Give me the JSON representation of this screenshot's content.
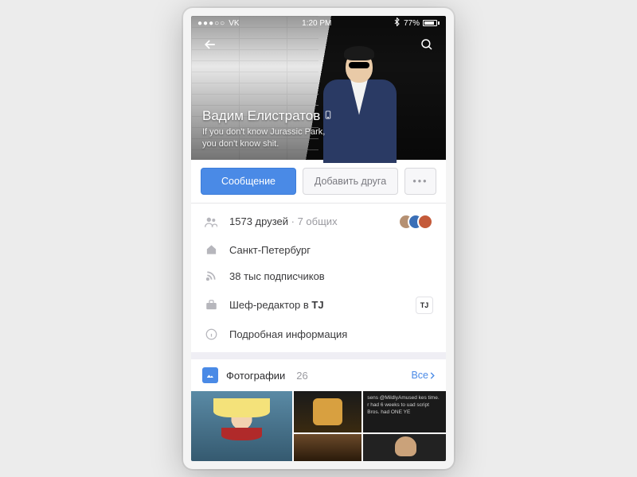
{
  "statusbar": {
    "carrier": "VK",
    "signal": "●●●○○",
    "time": "1:20 PM",
    "bt_icon": "bluetooth",
    "battery_pct": "77%"
  },
  "header": {
    "name": "Вадим Елистратов",
    "status_line1": "If you don't know Jurassic Park,",
    "status_line2": "you don't know shit."
  },
  "actions": {
    "message": "Сообщение",
    "add_friend": "Добавить друга",
    "more": "•••"
  },
  "info": {
    "friends_count": "1573 друзей",
    "mutual": "7 общих",
    "city": "Санкт-Петербург",
    "followers": "38 тыс подписчиков",
    "job_prefix": "Шеф-редактор в ",
    "job_place": "TJ",
    "details": "Подробная информация"
  },
  "photos": {
    "title": "Фотографии",
    "count": "26",
    "all": "Все",
    "tweet_text": "sens @MildlyAmused\nkes time.\nr had 6 weeks to\nuad script\nBros. had ONE YE"
  }
}
